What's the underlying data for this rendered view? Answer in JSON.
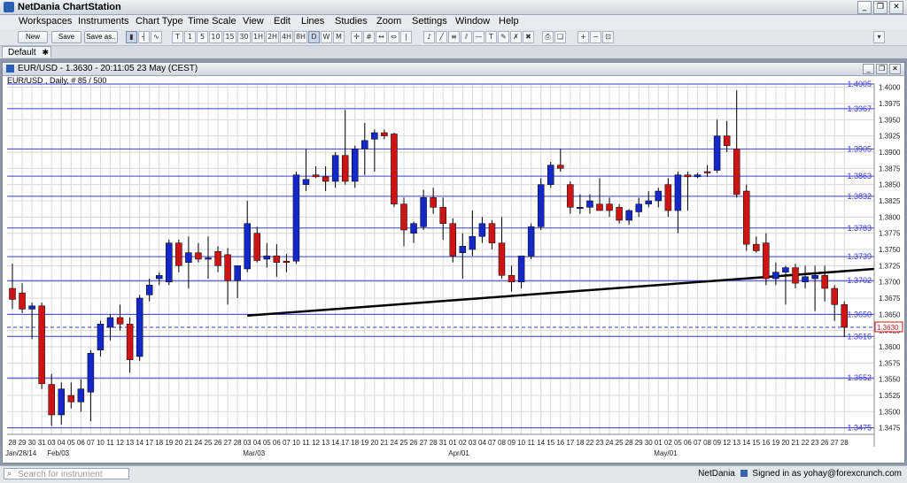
{
  "window": {
    "title": "NetDania ChartStation"
  },
  "menu": [
    "Workspaces",
    "Instruments",
    "Chart Type",
    "Time Scale",
    "View",
    "Edit",
    "Lines",
    "Studies",
    "Zoom",
    "Settings",
    "Window",
    "Help"
  ],
  "toolbar": {
    "new_label": "New",
    "save_label": "Save",
    "saveas_label": "Save as..",
    "timescales": [
      "T",
      "1",
      "5",
      "10",
      "15",
      "30",
      "1H",
      "2H",
      "4H",
      "8H",
      "D",
      "W",
      "M"
    ],
    "active_timescale": "D"
  },
  "tab": {
    "label": "Default"
  },
  "chart_window": {
    "title": "EUR/USD - 1.3630 - 20:11:05  23 May (CEST)",
    "subtitle": "EUR/USD , Daily, # 85 / 500"
  },
  "colors": {
    "up": "#1428c8",
    "down": "#cc1414",
    "level_line": "#3a3ad0",
    "grid": "#d8d8d8"
  },
  "chart_data": {
    "type": "candlestick",
    "ylim": [
      1.3465,
      1.4005
    ],
    "y_ticks": [
      1.3475,
      1.35,
      1.3525,
      1.355,
      1.3575,
      1.36,
      1.3625,
      1.365,
      1.3675,
      1.37,
      1.3725,
      1.375,
      1.3775,
      1.38,
      1.3825,
      1.385,
      1.3875,
      1.39,
      1.3925,
      1.395,
      1.3975,
      1.4
    ],
    "x_tick_labels": [
      "28",
      "29",
      "30",
      "31",
      "03",
      "04",
      "05",
      "06",
      "07",
      "10",
      "11",
      "12",
      "13",
      "14",
      "17",
      "18",
      "19",
      "20",
      "21",
      "24",
      "25",
      "26",
      "27",
      "28",
      "03",
      "04",
      "05",
      "06",
      "07",
      "10",
      "11",
      "12",
      "13",
      "14",
      "17",
      "18",
      "19",
      "20",
      "21",
      "24",
      "25",
      "26",
      "27",
      "28",
      "31",
      "01",
      "02",
      "03",
      "04",
      "07",
      "08",
      "09",
      "10",
      "11",
      "14",
      "15",
      "16",
      "17",
      "18",
      "22",
      "23",
      "24",
      "25",
      "28",
      "29",
      "30",
      "01",
      "02",
      "05",
      "06",
      "07",
      "08",
      "09",
      "12",
      "13",
      "14",
      "15",
      "16",
      "19",
      "20",
      "21",
      "22",
      "23",
      "26",
      "27",
      "28"
    ],
    "month_labels": [
      {
        "label": "Jan/28/14",
        "index": 0
      },
      {
        "label": "Feb/03",
        "index": 4
      },
      {
        "label": "Mar/03",
        "index": 24
      },
      {
        "label": "Apr/01",
        "index": 45
      },
      {
        "label": "May/01",
        "index": 66
      }
    ],
    "horizontal_levels": [
      1.4005,
      1.3967,
      1.3905,
      1.3863,
      1.3832,
      1.3783,
      1.3739,
      1.3702,
      1.365,
      1.3616,
      1.3552,
      1.3475
    ],
    "current_price": 1.363,
    "trendline": {
      "start": {
        "index": 24,
        "price": 1.3648
      },
      "end": {
        "index": 88,
        "price": 1.372
      }
    },
    "candles": [
      [
        1.369,
        1.3728,
        1.3658,
        1.3673
      ],
      [
        1.3683,
        1.3698,
        1.3652,
        1.3658
      ],
      [
        1.3658,
        1.3668,
        1.3612,
        1.3663
      ],
      [
        1.3663,
        1.3668,
        1.3535,
        1.3543
      ],
      [
        1.3542,
        1.3558,
        1.3478,
        1.3495
      ],
      [
        1.3495,
        1.3545,
        1.348,
        1.3535
      ],
      [
        1.3525,
        1.3545,
        1.3505,
        1.3515
      ],
      [
        1.3515,
        1.355,
        1.35,
        1.3535
      ],
      [
        1.353,
        1.3595,
        1.3485,
        1.359
      ],
      [
        1.3595,
        1.364,
        1.3585,
        1.3635
      ],
      [
        1.363,
        1.365,
        1.361,
        1.3645
      ],
      [
        1.3645,
        1.3665,
        1.3625,
        1.3635
      ],
      [
        1.3635,
        1.3645,
        1.356,
        1.358
      ],
      [
        1.3585,
        1.368,
        1.3578,
        1.3675
      ],
      [
        1.368,
        1.3705,
        1.367,
        1.3695
      ],
      [
        1.3705,
        1.3715,
        1.3695,
        1.371
      ],
      [
        1.37,
        1.3765,
        1.3695,
        1.376
      ],
      [
        1.376,
        1.3765,
        1.3715,
        1.3725
      ],
      [
        1.373,
        1.377,
        1.369,
        1.3745
      ],
      [
        1.3745,
        1.376,
        1.373,
        1.3735
      ],
      [
        1.3735,
        1.377,
        1.3705,
        1.3737
      ],
      [
        1.3747,
        1.3755,
        1.3715,
        1.3725
      ],
      [
        1.3742,
        1.3752,
        1.3665,
        1.3702
      ],
      [
        1.3702,
        1.3718,
        1.3675,
        1.3725
      ],
      [
        1.372,
        1.3825,
        1.3715,
        1.379
      ],
      [
        1.3775,
        1.3785,
        1.373,
        1.3733
      ],
      [
        1.3735,
        1.376,
        1.3722,
        1.374
      ],
      [
        1.374,
        1.3758,
        1.3708,
        1.373
      ],
      [
        1.3732,
        1.3743,
        1.3715,
        1.373
      ],
      [
        1.3732,
        1.387,
        1.3728,
        1.3865
      ],
      [
        1.385,
        1.3905,
        1.384,
        1.3858
      ],
      [
        1.3865,
        1.3878,
        1.386,
        1.3862
      ],
      [
        1.3862,
        1.3878,
        1.384,
        1.3855
      ],
      [
        1.3855,
        1.39,
        1.3845,
        1.3895
      ],
      [
        1.3895,
        1.3965,
        1.385,
        1.3855
      ],
      [
        1.3855,
        1.391,
        1.3845,
        1.3905
      ],
      [
        1.3905,
        1.3945,
        1.3865,
        1.3918
      ],
      [
        1.392,
        1.3935,
        1.387,
        1.393
      ],
      [
        1.393,
        1.3935,
        1.392,
        1.3925
      ],
      [
        1.3928,
        1.393,
        1.3815,
        1.382
      ],
      [
        1.382,
        1.383,
        1.3755,
        1.378
      ],
      [
        1.3775,
        1.3793,
        1.376,
        1.379
      ],
      [
        1.3785,
        1.3842,
        1.378,
        1.383
      ],
      [
        1.383,
        1.3845,
        1.3805,
        1.3815
      ],
      [
        1.3815,
        1.383,
        1.3765,
        1.379
      ],
      [
        1.379,
        1.3798,
        1.373,
        1.374
      ],
      [
        1.3745,
        1.3775,
        1.3705,
        1.3755
      ],
      [
        1.375,
        1.381,
        1.374,
        1.377
      ],
      [
        1.377,
        1.38,
        1.376,
        1.379
      ],
      [
        1.379,
        1.3795,
        1.375,
        1.376
      ],
      [
        1.376,
        1.38,
        1.3705,
        1.371
      ],
      [
        1.371,
        1.3725,
        1.3685,
        1.37
      ],
      [
        1.37,
        1.3735,
        1.369,
        1.374
      ],
      [
        1.374,
        1.379,
        1.3735,
        1.3785
      ],
      [
        1.3785,
        1.386,
        1.378,
        1.385
      ],
      [
        1.385,
        1.3885,
        1.3845,
        1.388
      ],
      [
        1.388,
        1.3905,
        1.387,
        1.3875
      ],
      [
        1.385,
        1.3855,
        1.3805,
        1.3815
      ],
      [
        1.3815,
        1.3835,
        1.3805,
        1.3815
      ],
      [
        1.3815,
        1.3835,
        1.3805,
        1.3825
      ],
      [
        1.382,
        1.386,
        1.3815,
        1.381
      ],
      [
        1.382,
        1.383,
        1.38,
        1.381
      ],
      [
        1.3815,
        1.382,
        1.379,
        1.3795
      ],
      [
        1.3795,
        1.3812,
        1.3788,
        1.381
      ],
      [
        1.3808,
        1.383,
        1.38,
        1.382
      ],
      [
        1.382,
        1.384,
        1.3815,
        1.3825
      ],
      [
        1.3825,
        1.3845,
        1.3815,
        1.384
      ],
      [
        1.385,
        1.386,
        1.38,
        1.381
      ],
      [
        1.381,
        1.387,
        1.3775,
        1.3865
      ],
      [
        1.3865,
        1.387,
        1.381,
        1.3862
      ],
      [
        1.3862,
        1.3868,
        1.386,
        1.3865
      ],
      [
        1.387,
        1.388,
        1.3862,
        1.3868
      ],
      [
        1.3872,
        1.395,
        1.3868,
        1.3925
      ],
      [
        1.3925,
        1.3948,
        1.39,
        1.391
      ],
      [
        1.3905,
        1.3995,
        1.383,
        1.3835
      ],
      [
        1.384,
        1.385,
        1.3748,
        1.3758
      ],
      [
        1.3758,
        1.377,
        1.3745,
        1.3748
      ],
      [
        1.376,
        1.3775,
        1.3695,
        1.3705
      ],
      [
        1.3705,
        1.373,
        1.3695,
        1.3715
      ],
      [
        1.3715,
        1.3725,
        1.3665,
        1.3722
      ],
      [
        1.3722,
        1.3728,
        1.369,
        1.3698
      ],
      [
        1.37,
        1.3725,
        1.369,
        1.3708
      ],
      [
        1.3705,
        1.3725,
        1.3655,
        1.371
      ],
      [
        1.371,
        1.3725,
        1.367,
        1.369
      ],
      [
        1.369,
        1.3695,
        1.364,
        1.3665
      ],
      [
        1.3665,
        1.367,
        1.3615,
        1.363
      ]
    ]
  }
}
